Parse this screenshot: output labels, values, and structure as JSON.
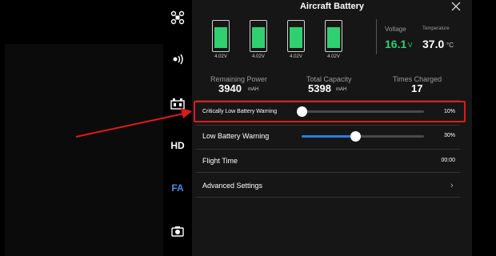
{
  "panel": {
    "title": "Aircraft Battery",
    "close_icon": "close-icon"
  },
  "sidebar": {
    "items": [
      {
        "name": "aircraft-icon"
      },
      {
        "name": "signal-icon"
      },
      {
        "name": "battery-icon"
      },
      {
        "name": "hd-icon",
        "label": "HD"
      },
      {
        "name": "fa-icon",
        "label": "FA"
      },
      {
        "name": "camera-icon"
      }
    ]
  },
  "cells": [
    {
      "voltage": "4.02V",
      "level": 0.85
    },
    {
      "voltage": "4.02V",
      "level": 0.85
    },
    {
      "voltage": "4.02V",
      "level": 0.85
    },
    {
      "voltage": "4.02V",
      "level": 0.85
    }
  ],
  "readouts": {
    "voltage_label": "Voltage",
    "voltage_value": "16.1",
    "voltage_unit": "V",
    "temperature_label": "Temperature",
    "temperature_value": "37.0",
    "temperature_unit": "°C"
  },
  "stats": {
    "remaining_label": "Remaining Power",
    "remaining_value": "3940",
    "remaining_unit": "mAH",
    "capacity_label": "Total Capacity",
    "capacity_value": "5398",
    "capacity_unit": "mAH",
    "charged_label": "Times Charged",
    "charged_value": "17"
  },
  "settings": {
    "critical_label": "Critically Low Battery Warning",
    "critical_value": "10%",
    "critical_percent": 0.0,
    "low_label": "Low Battery Warning",
    "low_value": "30%",
    "low_percent": 0.44,
    "flight_time_label": "Flight Time",
    "flight_time_value": "00:00",
    "advanced_label": "Advanced Settings"
  },
  "colors": {
    "accent_green": "#2fd070",
    "slider_blue": "#2a7ee0",
    "highlight_red": "#e01a1a"
  }
}
